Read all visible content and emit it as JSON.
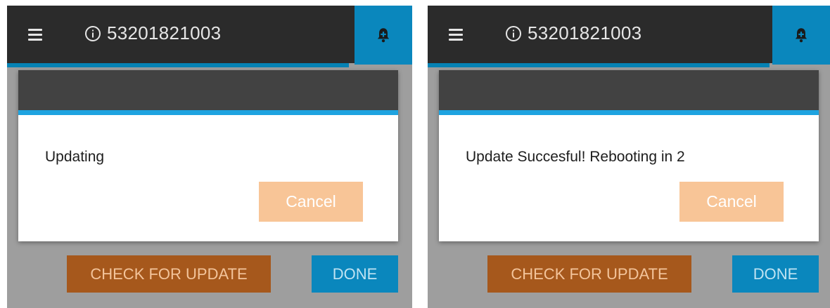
{
  "panels": [
    {
      "device_id": "53201821003",
      "dialog_message": "Updating",
      "cancel_label": "Cancel",
      "check_update_label": "CHECK FOR UPDATE",
      "done_label": "DONE"
    },
    {
      "device_id": "53201821003",
      "dialog_message": "Update Succesful! Rebooting in 2",
      "cancel_label": "Cancel",
      "check_update_label": "CHECK FOR UPDATE",
      "done_label": "DONE"
    }
  ],
  "icons": {
    "menu": "hamburger-menu-icon",
    "info": "info-icon",
    "notification": "bell-plus-icon"
  },
  "colors": {
    "topbar": "#2b2b2b",
    "accent_blue": "#0a87bd",
    "dialog_header": "#424242",
    "dialog_accent": "#1ea3e0",
    "cancel_button": "#f8c597",
    "check_update_button": "#a6581c",
    "screen_background": "#9e9e9e"
  }
}
